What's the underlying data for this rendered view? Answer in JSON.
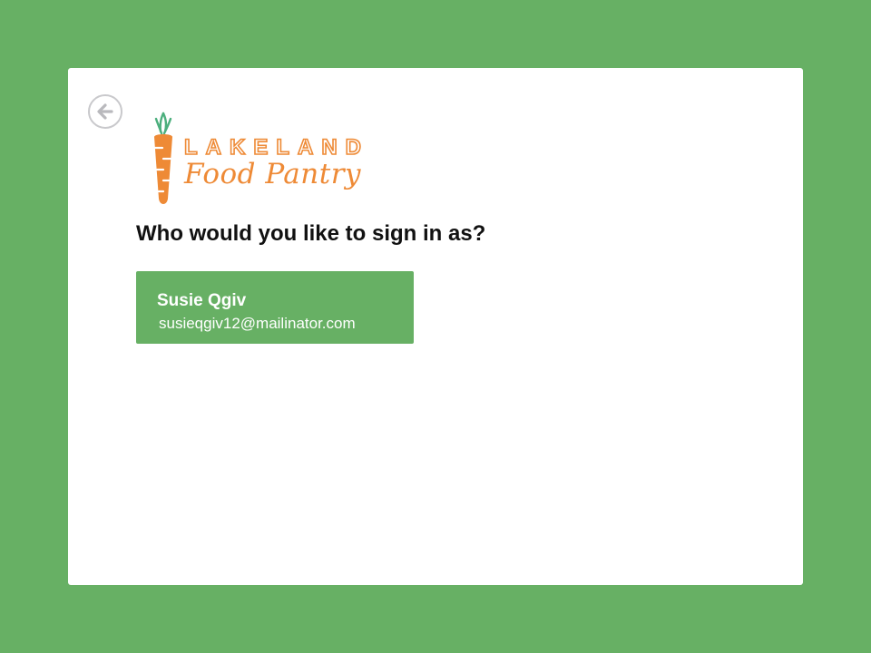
{
  "logo": {
    "title": "LAKELAND",
    "subtitle": "Food Pantry"
  },
  "prompt": "Who would you like to sign in as?",
  "accounts": [
    {
      "name": "Susie Qgiv",
      "email": "susieqgiv12@mailinator.com"
    }
  ],
  "colors": {
    "background": "#67b064",
    "card": "#ffffff",
    "brand_orange": "#ee8a36",
    "leaf_green": "#4caf7d",
    "account_button": "#67b064"
  },
  "icons": {
    "back": "arrow-left-circle-icon",
    "logo_mark": "carrot-icon"
  }
}
